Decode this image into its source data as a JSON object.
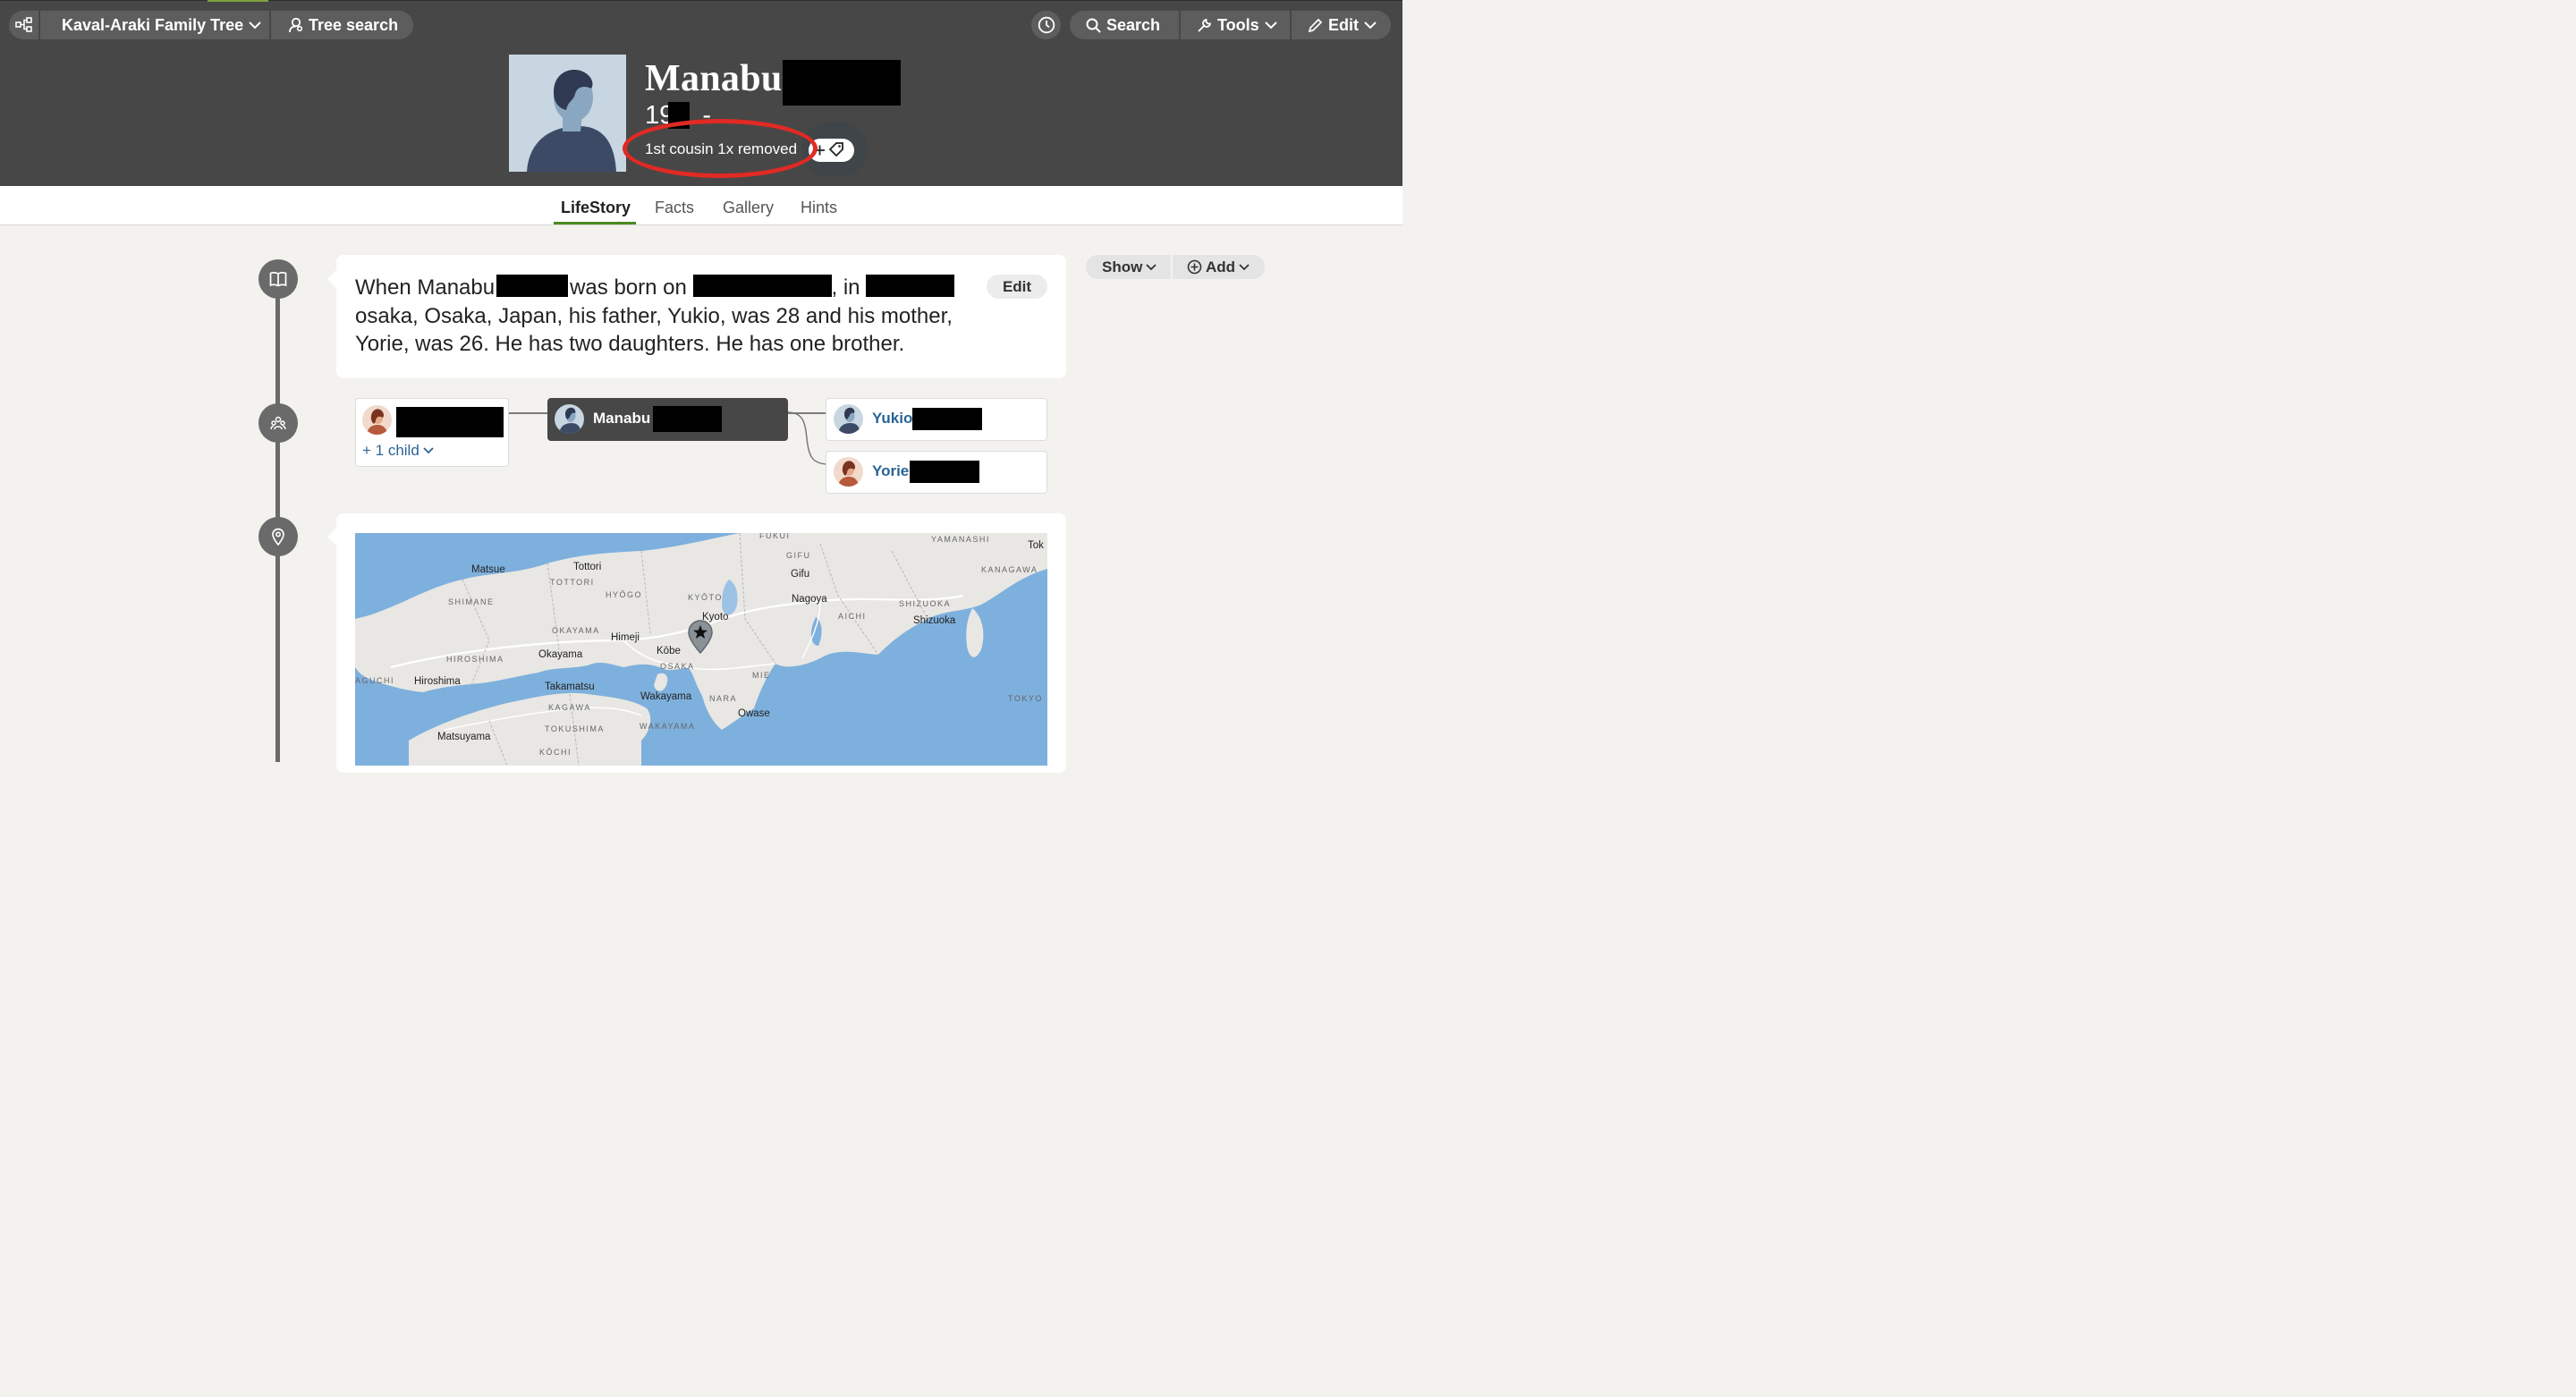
{
  "header": {
    "tree_name": "Kaval-Araki Family Tree",
    "tree_search": "Tree search",
    "search": "Search",
    "tools": "Tools",
    "edit": "Edit"
  },
  "profile": {
    "first_name": "Manabu",
    "dates_prefix": "19",
    "dates_suffix": " -",
    "relationship": "1st cousin 1x removed"
  },
  "tabs": [
    {
      "label": "LifeStory",
      "active": true
    },
    {
      "label": "Facts",
      "active": false
    },
    {
      "label": "Gallery",
      "active": false
    },
    {
      "label": "Hints",
      "active": false
    }
  ],
  "side_actions": {
    "show": "Show",
    "add": "Add"
  },
  "story": {
    "part1": "When Manabu",
    "part2": "was born on",
    "part3": ", in",
    "part4": "osaka, Osaka, Japan, his father, Yukio, was 28 and his mother, Yorie, was 26. He has two daughters. He has one brother.",
    "edit_label": "Edit"
  },
  "family": {
    "spouse_child_link": "+ 1 child",
    "self_name": "Manabu",
    "father_name": "Yukio",
    "mother_name": "Yorie"
  },
  "map": {
    "labels": [
      {
        "text": "FUKUI",
        "kind": "region"
      },
      {
        "text": "YAMANASHI",
        "kind": "region"
      },
      {
        "text": "Tok",
        "kind": "city"
      },
      {
        "text": "Matsue",
        "kind": "city"
      },
      {
        "text": "Tottori",
        "kind": "city"
      },
      {
        "text": "TOTTORI",
        "kind": "region"
      },
      {
        "text": "GIFU",
        "kind": "region"
      },
      {
        "text": "Gifu",
        "kind": "city"
      },
      {
        "text": "KANAGAWA",
        "kind": "region"
      },
      {
        "text": "SHIMANE",
        "kind": "region"
      },
      {
        "text": "HYŌGO",
        "kind": "region"
      },
      {
        "text": "KYŌTO",
        "kind": "region"
      },
      {
        "text": "Nagoya",
        "kind": "city"
      },
      {
        "text": "SHIZUOKA",
        "kind": "region"
      },
      {
        "text": "Kyoto",
        "kind": "city"
      },
      {
        "text": "AICHI",
        "kind": "region"
      },
      {
        "text": "Shizuoka",
        "kind": "city"
      },
      {
        "text": "OKAYAMA",
        "kind": "region"
      },
      {
        "text": "Himeji",
        "kind": "city"
      },
      {
        "text": "Kōbe",
        "kind": "city"
      },
      {
        "text": "Okayama",
        "kind": "city"
      },
      {
        "text": "HIROSHIMA",
        "kind": "region"
      },
      {
        "text": "OSAKA",
        "kind": "region"
      },
      {
        "text": "MIE",
        "kind": "region"
      },
      {
        "text": "AGUCHI",
        "kind": "region"
      },
      {
        "text": "Hiroshima",
        "kind": "city"
      },
      {
        "text": "Takamatsu",
        "kind": "city"
      },
      {
        "text": "Wakayama",
        "kind": "city"
      },
      {
        "text": "NARA",
        "kind": "region"
      },
      {
        "text": "TOKYO",
        "kind": "region"
      },
      {
        "text": "KAGAWA",
        "kind": "region"
      },
      {
        "text": "Owase",
        "kind": "city"
      },
      {
        "text": "WAKAYAMA",
        "kind": "region"
      },
      {
        "text": "TOKUSHIMA",
        "kind": "region"
      },
      {
        "text": "Matsuyama",
        "kind": "city"
      },
      {
        "text": "KŌCHI",
        "kind": "region"
      }
    ]
  },
  "colors": {
    "header_bg": "#474747",
    "accent_green": "#4a8a1e",
    "link_blue": "#2a6496",
    "annotation_red": "#e02a24",
    "map_water": "#7eb0dd"
  }
}
